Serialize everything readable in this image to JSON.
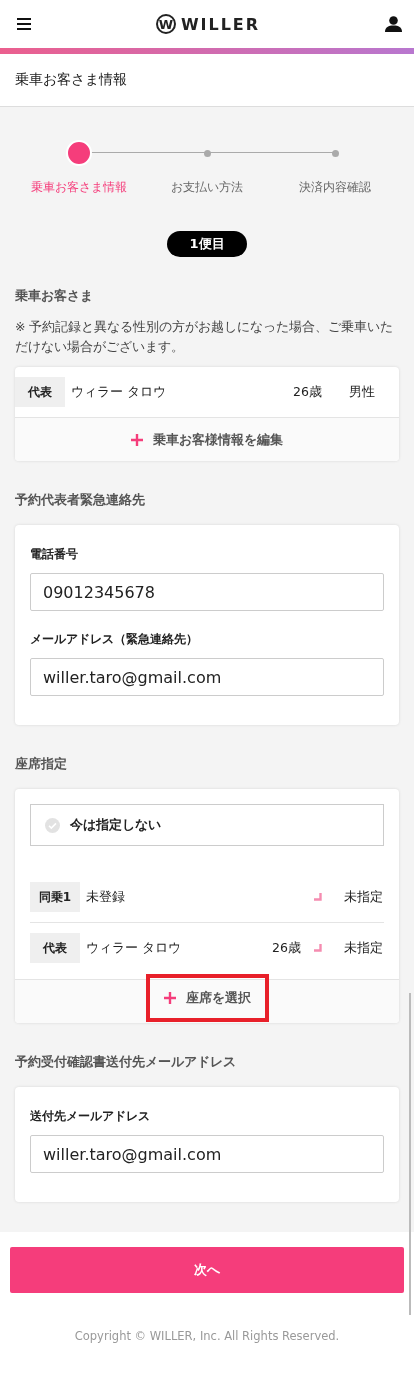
{
  "header": {
    "logo_mark": "W",
    "logo_text": "WILLER"
  },
  "page_title": "乗車お客さま情報",
  "steps": [
    {
      "label": "乗車お客さま情報",
      "selected": true
    },
    {
      "label": "お支払い方法",
      "selected": false
    },
    {
      "label": "決済内容確認",
      "selected": false
    }
  ],
  "trip_badge": "1便目",
  "passengers_section": {
    "heading": "乗車お客さま",
    "notice": "※ 予約記録と異なる性別の方がお越しになった場合、ご乗車いただけない場合がございます。",
    "rows": [
      {
        "role": "代表",
        "name": "ウィラー タロウ",
        "age": "26歳",
        "gender": "男性"
      }
    ],
    "edit_button": "乗車お客様情報を編集"
  },
  "emergency_section": {
    "heading": "予約代表者緊急連絡先",
    "fields": [
      {
        "label": "電話番号",
        "value": "09012345678"
      },
      {
        "label": "メールアドレス（緊急連絡先）",
        "value": "willer.taro@gmail.com"
      }
    ]
  },
  "seat_section": {
    "heading": "座席指定",
    "skip_option": {
      "label": "今は指定しない",
      "checked": false
    },
    "rows": [
      {
        "role": "同乗1",
        "name": "未登録",
        "seat": "未指定"
      },
      {
        "role": "代表",
        "name": "ウィラー タロウ",
        "age": "26歳",
        "seat": "未指定"
      }
    ],
    "select_button": {
      "label": "座席を選択",
      "highlighted": true
    }
  },
  "confirmation_section": {
    "heading": "予約受付確認書送付先メールアドレス",
    "fields": [
      {
        "label": "送付先メールアドレス",
        "value": "willer.taro@gmail.com"
      }
    ]
  },
  "next_button": "次へ",
  "copyright": "Copyright © WILLER, Inc. All Rights Reserved."
}
